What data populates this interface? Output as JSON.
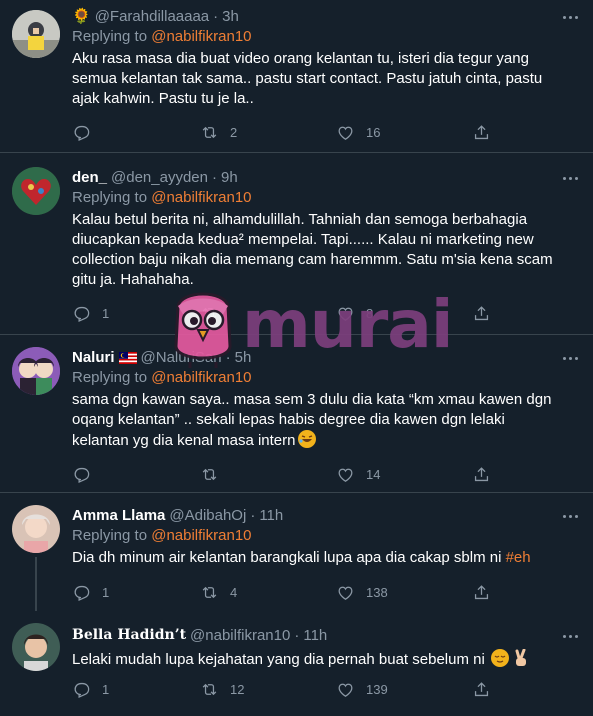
{
  "tweets": [
    {
      "name": "Farahdillaaaaa",
      "name_emoji": "🌻",
      "handle": "@Farahdillaaaaa",
      "time": "3h",
      "replying_label": "Replying to",
      "replying_to": "@nabilfikran10",
      "text": "Aku rasa masa dia buat video orang kelantan tu, isteri dia tegur yang semua kelantan tak sama.. pastu start contact. Pastu jatuh cinta, pastu ajak kahwin. Pastu tu je la..",
      "replies": "",
      "retweets": "2",
      "likes": "16"
    },
    {
      "name": "den_",
      "handle": "@den_ayyden",
      "time": "9h",
      "replying_label": "Replying to",
      "replying_to": "@nabilfikran10",
      "text": "Kalau betul berita ni, alhamdulillah. Tahniah dan semoga berbahagia diucapkan kepada kedua² mempelai. Tapi...... Kalau ni marketing new collection baju nikah dia memang cam haremmm. Satu m'sia kena scam gitu ja. Hahahaha.",
      "replies": "1",
      "retweets": "",
      "likes": "8"
    },
    {
      "name": "Naluri",
      "handle": "@NaluriSan",
      "time": "5h",
      "replying_label": "Replying to",
      "replying_to": "@nabilfikran10",
      "text": "sama dgn kawan saya.. masa sem 3 dulu dia kata “km xmau kawen dgn oqang kelantan” .. sekali lepas habis degree dia kawen dgn lelaki kelantan yg dia kenal masa intern",
      "replies": "",
      "retweets": "",
      "likes": "14"
    },
    {
      "name": "Amma Llama",
      "handle": "@AdibahOj",
      "time": "11h",
      "replying_label": "Replying to",
      "replying_to": "@nabilfikran10",
      "text": "Dia dh minum air kelantan barangkali lupa apa dia cakap sblm ni ",
      "hashtag": "#eh",
      "replies": "1",
      "retweets": "4",
      "likes": "138"
    },
    {
      "name": "Bella Hadidn’t",
      "handle": "@nabilfikran10",
      "time": "11h",
      "text": "Lelaki mudah lupa kejahatan yang dia pernah buat sebelum ni",
      "replies": "1",
      "retweets": "12",
      "likes": "139"
    }
  ],
  "watermark": {
    "brand": "murai"
  },
  "colors": {
    "background": "#15202b",
    "accent": "#ef7e35",
    "muted": "#8b98a5",
    "divider": "#38444d",
    "watermark": "#7d3f7d"
  }
}
